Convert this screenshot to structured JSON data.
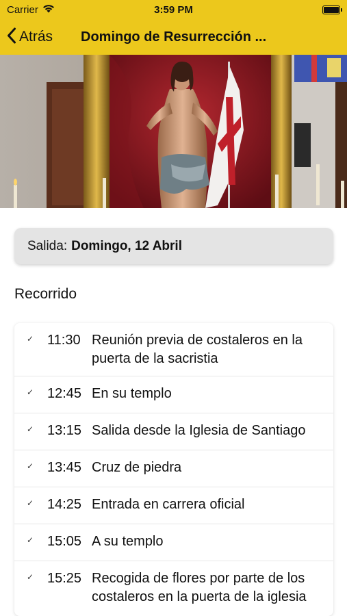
{
  "status": {
    "carrier": "Carrier",
    "time": "3:59 PM"
  },
  "nav": {
    "back_label": "Atrás",
    "title": "Domingo de Resurrección ..."
  },
  "salida": {
    "label": "Salida:",
    "value": "Domingo, 12 Abril"
  },
  "recorrido": {
    "title": "Recorrido",
    "items": [
      {
        "time": "11:30",
        "text": "Reunión previa de costaleros en la puerta de la sacristia"
      },
      {
        "time": "12:45",
        "text": "En su templo"
      },
      {
        "time": "13:15",
        "text": "Salida desde la Iglesia de Santiago"
      },
      {
        "time": "13:45",
        "text": "Cruz de piedra"
      },
      {
        "time": "14:25",
        "text": "Entrada en carrera oficial"
      },
      {
        "time": "15:05",
        "text": "A su templo"
      },
      {
        "time": "15:25",
        "text": "Recogida de flores por parte de los costaleros en la puerta de la iglesia"
      }
    ]
  }
}
